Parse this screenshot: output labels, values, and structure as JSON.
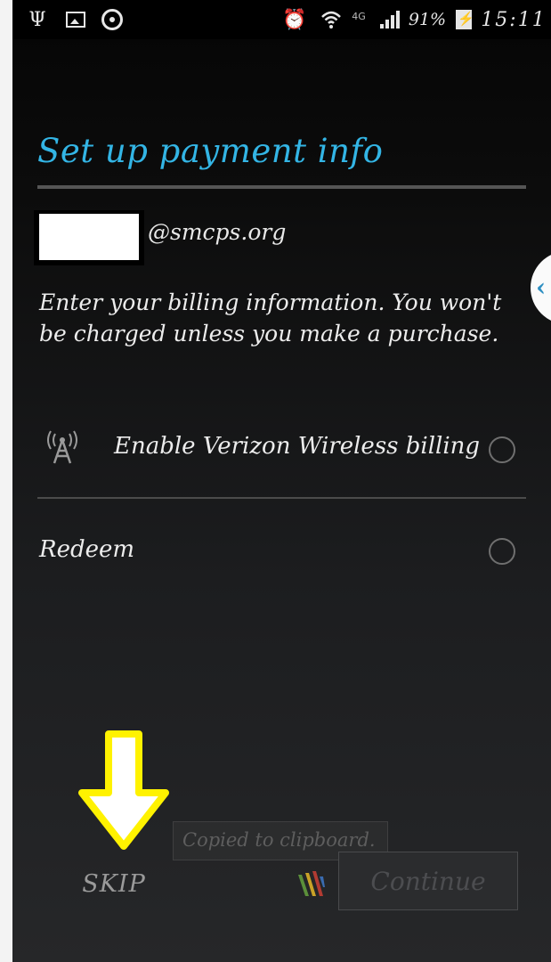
{
  "status_bar": {
    "icons": [
      "usb-icon",
      "image-icon",
      "steering-wheel-icon",
      "alarm-icon",
      "wifi-icon",
      "signal-icon",
      "battery-charging-icon"
    ],
    "network": "4G",
    "battery": "91%",
    "time": "15:11"
  },
  "title": "Set up payment info",
  "account": {
    "domain": "@smcps.org"
  },
  "description": "Enter your billing information. You won't be charged unless you make a purchase.",
  "options": [
    {
      "label": "Enable Verizon Wireless billing",
      "icon": "antenna-icon",
      "selected": false
    },
    {
      "label": "Redeem",
      "selected": false
    }
  ],
  "toast": "Copied to clipboard.",
  "footer": {
    "skip_label": "SKIP",
    "continue_label": "Continue"
  },
  "colors": {
    "accent": "#33b5e5",
    "annotation_arrow": "#fff200"
  }
}
